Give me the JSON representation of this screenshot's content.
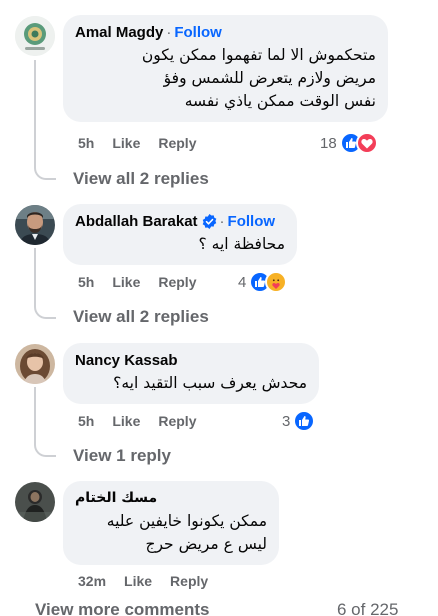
{
  "comments": [
    {
      "author": "Amal Magdy",
      "follow": "Follow",
      "text": [
        "متحكموش الا لما تفهموا ممكن يكون",
        "مريض ولازم يتعرض للشمس وفؤ",
        "نفس الوقت ممكن ياذي نفسه"
      ],
      "time": "5h",
      "like": "Like",
      "reply": "Reply",
      "reaction_count": "18",
      "view_replies": "View all 2 replies"
    },
    {
      "author": "Abdallah Barakat",
      "follow": "Follow",
      "text": [
        "محافظة ايه ؟"
      ],
      "time": "5h",
      "like": "Like",
      "reply": "Reply",
      "reaction_count": "4",
      "view_replies": "View all 2 replies"
    },
    {
      "author": "Nancy Kassab",
      "text": [
        "محدش يعرف سبب التقيد ايه؟"
      ],
      "time": "5h",
      "like": "Like",
      "reply": "Reply",
      "reaction_count": "3",
      "view_replies": "View 1 reply"
    },
    {
      "author": "مسك الختام",
      "text": [
        "ممكن يكونوا خايفين عليه",
        "ليس ع مريض حرج"
      ],
      "time": "32m",
      "like": "Like",
      "reply": "Reply"
    }
  ],
  "footer": {
    "view_more": "View more comments",
    "pagination": "6 of 225"
  },
  "colors": {
    "accent": "#0866ff",
    "bubble": "#f0f2f5",
    "secondary_text": "#65676b",
    "love": "#f33e58",
    "care": "#f7b125"
  },
  "icons": [
    "like-reaction-icon",
    "love-reaction-icon",
    "care-reaction-icon",
    "verified-badge-icon"
  ]
}
